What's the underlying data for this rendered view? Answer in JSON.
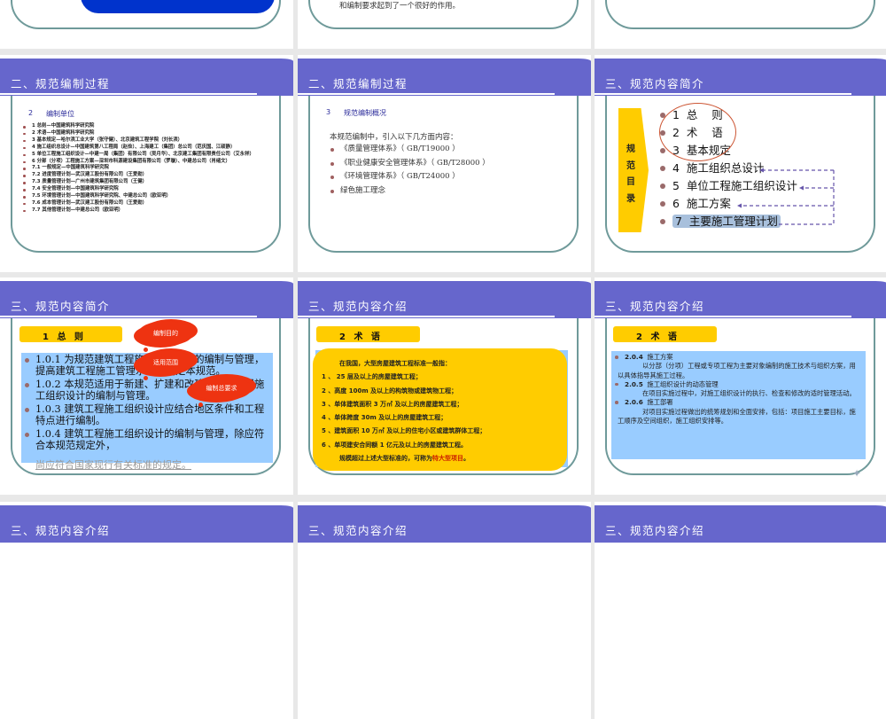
{
  "row0": {
    "col1_text": "和编制要求起到了一个很好的作用。"
  },
  "slides": {
    "s1": {
      "title": "二、规范编制过程",
      "section_num": "2",
      "section_title": "编制单位",
      "items": [
        "1 总则—中国建筑科学研究院",
        "2 术语—中国建筑科学研究院",
        "3 基本规定—哈尔滨工业大学（张守健）、北京建筑工程学院（刘长滨）",
        "4 施工组织总设计—中国建筑第八工程局（赵俭）、上海建工（集团）总公司（范庆国、江硕静）",
        "5 单位工程施工组织设计—中建一局（集团）有限公司（吴月华）、北京建工集团有限责任公司（艾永祥）",
        "6 分部（分项）工程施工方案—深圳市科源建设集团有限公司（罗璇）、中建总公司（肖绪文）",
        "7.1 一般规定—中国建筑科学研究院",
        "7.2 进度管理计划—武汉建工股份有限公司（王爱勋）",
        "7.3 质量管理计划—广州市建筑集团有限公司（王健）",
        "7.4 安全管理计划—中国建筑科学研究院",
        "7.5 环境管理计划—中国建筑科学研究院、中建总公司（欧亚明）",
        "7.6 成本管理计划—武汉建工股份有限公司（王爱勋）",
        "7.7 其他管理计划—中建总公司（欧亚明）"
      ]
    },
    "s2": {
      "title": "二、规范编制过程",
      "section_num": "3",
      "section_title": "规范编制概况",
      "intro": "本规范编制中，引入以下几方面内容：",
      "items": [
        "《质量管理体系》（ GB/T19000 ）",
        "《职业健康安全管理体系》（ GB/T28000 ）",
        "《环境管理体系》（ GB/T24000 ）",
        "绿色施工理念"
      ]
    },
    "s3": {
      "title": "三、规范内容简介",
      "side_label": [
        "规",
        "范",
        "目",
        "录"
      ],
      "items": [
        "1  总    则",
        "2  术    语",
        "3  基本规定",
        "4  施工组织总设计",
        "5  单位工程施工组织设计",
        "6  施工方案",
        "7  主要施工管理计划"
      ]
    },
    "s4": {
      "title": "三、规范内容简介",
      "label": "1 总  则",
      "items": [
        "1.0.1  为规范建筑工程施工组织设计的编制与管理，提高建筑工程施工管理水平，制定本规范。",
        "1.0.2  本规范适用于新建、扩建和改建的建筑工程施工组织设计的编制与管理。",
        "1.0.3  建筑工程施工组织设计应结合地区条件和工程特点进行编制。",
        "1.0.4  建筑工程施工组织设计的编制与管理，除应符合本规范规定外，"
      ],
      "tail": "尚应符合国家现行有关标准的规定。",
      "callouts": [
        "编制目的",
        "适用范围",
        "编制总要求"
      ]
    },
    "s5": {
      "title": "三、规范内容介绍",
      "label": "2 术  语",
      "intro": "在我国，大型房屋建筑工程标准一般指：",
      "items": [
        "1 、 25 层及以上的房屋建筑工程；",
        "2 、高度 100m 及以上的构筑物或建筑物工程；",
        "3 、单体建筑面积 3 万㎡ 及以上的房屋建筑工程；",
        "4 、单体跨度 30m 及以上的房屋建筑工程；",
        "5 、建筑面积 10 万㎡ 及以上的住宅小区或建筑群体工程；",
        "6 、单项建安合同额 1 亿元及以上的房屋建筑工程。"
      ],
      "outro": "规模超过上述大型标准的，可称为",
      "highlight": "特大型项目",
      "outro_end": "。",
      "highlight_color": "#cc2200"
    },
    "s6": {
      "title": "三、规范内容介绍",
      "label": "2 术  语",
      "items": [
        {
          "num": "2.0.4",
          "term": "施工方案",
          "body": "以分部（分项）工程或专项工程为主要对象编制的施工技术与组织方案，用以具体指导其施工过程。"
        },
        {
          "num": "2.0.5",
          "term": "施工组织设计的动态管理",
          "body": "在项目实施过程中，对施工组织设计的执行、检查和修改的适时管理活动。"
        },
        {
          "num": "2.0.6",
          "term": "施工部署",
          "body": "对项目实施过程做出的统筹规划和全面安排，包括：项目施工主要目标，施工顺序及空间组织，施工组织安排等。"
        }
      ]
    },
    "s7": {
      "title": "三、规范内容介绍"
    },
    "s8": {
      "title": "三、规范内容介绍"
    },
    "s9": {
      "title": "三、规范内容介绍"
    }
  },
  "colors": {
    "band": "#6666cc",
    "yellow": "#ffcc00",
    "blue_box": "#99ccff",
    "frame": "#6f9a9a"
  }
}
